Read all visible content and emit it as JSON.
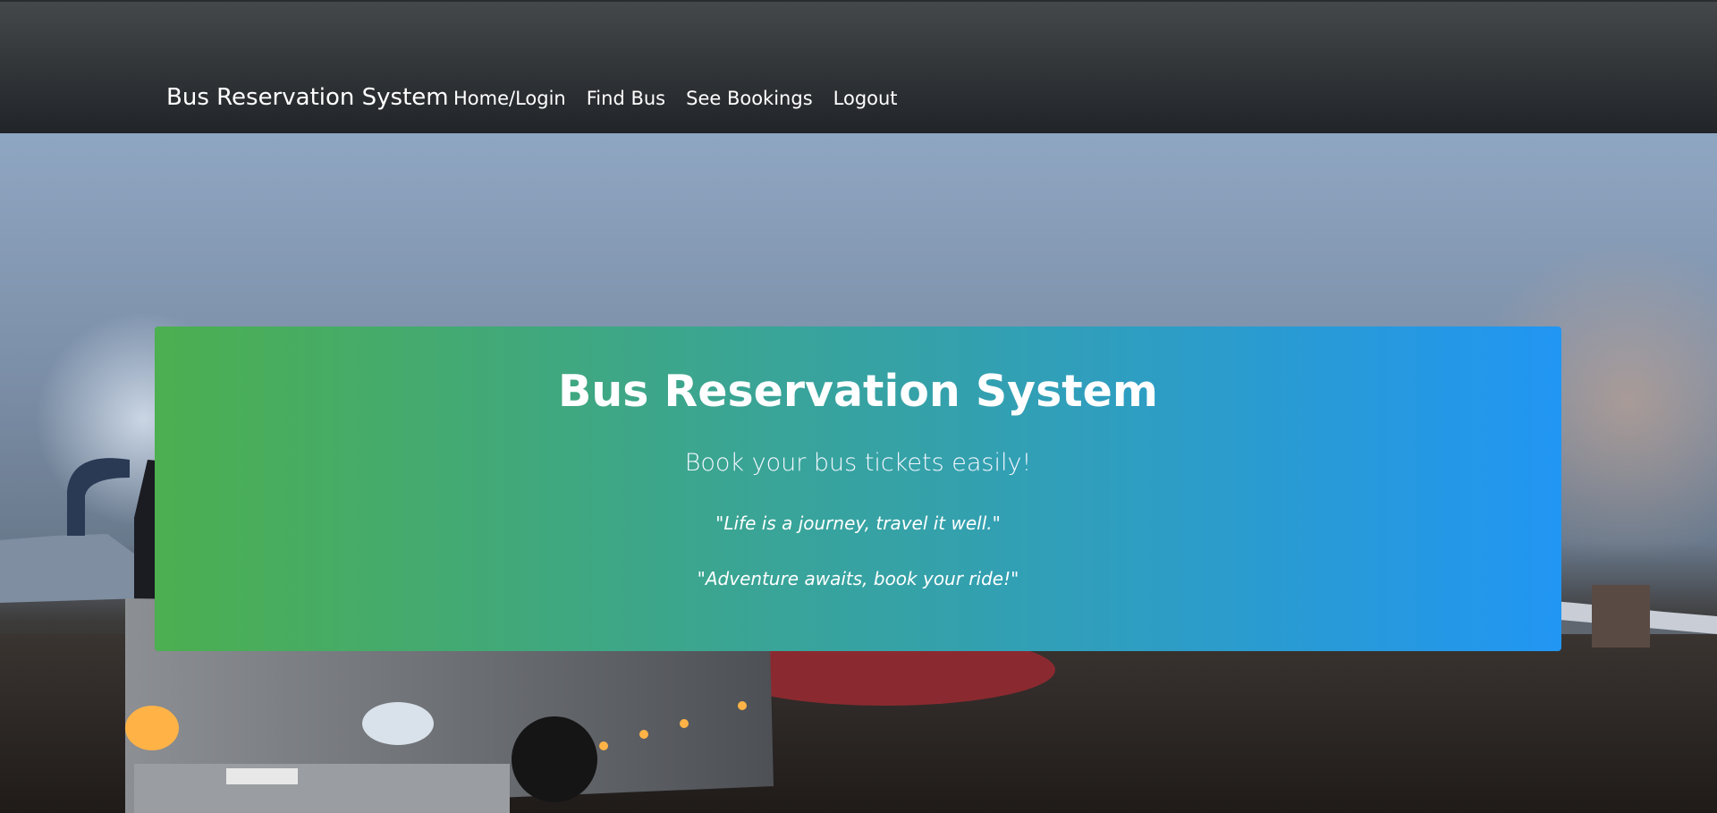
{
  "navbar": {
    "brand": "Bus Reservation System",
    "links": [
      {
        "label": "Home/Login"
      },
      {
        "label": "Find Bus"
      },
      {
        "label": "See Bookings"
      },
      {
        "label": "Logout"
      }
    ]
  },
  "hero": {
    "title": "Bus Reservation System",
    "subtitle": "Book your bus tickets easily!",
    "quotes": [
      "\"Life is a journey, travel it well.\"",
      "\"Adventure awaits, book your ride!\""
    ],
    "background": "bus-at-night-mountain-photo"
  },
  "colors": {
    "navbar_top": "#45484b",
    "navbar_bottom": "#212428",
    "card_gradient_start": "#4caf50",
    "card_gradient_end": "#2196f3",
    "text": "#ffffff"
  }
}
